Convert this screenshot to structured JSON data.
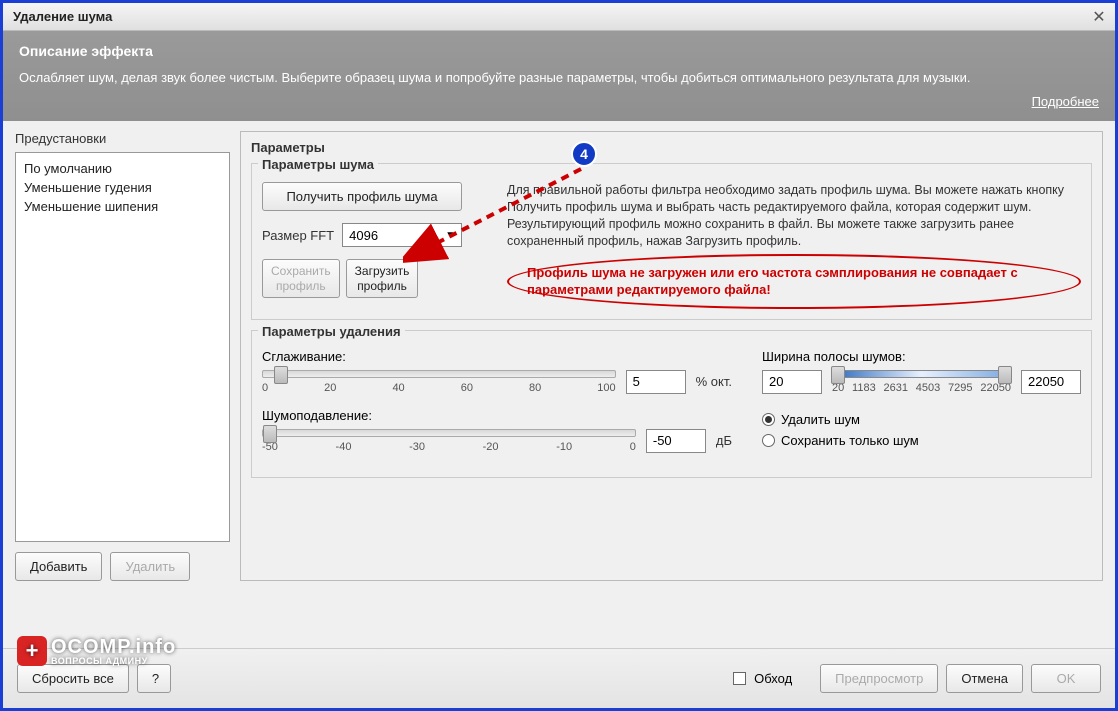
{
  "window": {
    "title": "Удаление шума"
  },
  "desc": {
    "title": "Описание эффекта",
    "text": "Ослабляет шум, делая звук более чистым. Выберите образец шума и попробуйте разные параметры, чтобы добиться оптимального результата для музыки.",
    "more": "Подробнее"
  },
  "presets": {
    "label": "Предустановки",
    "items": [
      "По умолчанию",
      "Уменьшение гудения",
      "Уменьшение шипения"
    ],
    "add": "Добавить",
    "remove": "Удалить"
  },
  "params": {
    "label": "Параметры",
    "noise": {
      "title": "Параметры шума",
      "get_profile": "Получить профиль шума",
      "fft_label": "Размер FFT",
      "fft_value": "4096",
      "save_profile": "Сохранить\nпрофиль",
      "load_profile": "Загрузить\nпрофиль",
      "info": "Для правильной работы фильтра необходимо задать профиль шума. Вы можете нажать кнопку Получить профиль шума и выбрать часть редактируемого файла, которая содержит шум. Результирующий профиль можно сохранить в файл. Вы можете также загрузить ранее сохраненный профиль, нажав Загрузить профиль.",
      "error": "Профиль шума не загружен или его частота сэмплирования не совпадает с параметрами редактируемого файла!"
    },
    "removal": {
      "title": "Параметры удаления",
      "smoothing_label": "Сглаживание:",
      "smoothing_value": "5",
      "smoothing_unit": "% окт.",
      "smoothing_ticks": [
        "0",
        "20",
        "40",
        "60",
        "80",
        "100"
      ],
      "reduction_label": "Шумоподавление:",
      "reduction_value": "-50",
      "reduction_unit": "дБ",
      "reduction_ticks": [
        "-50",
        "-40",
        "-30",
        "-20",
        "-10",
        "0"
      ],
      "bandwidth_label": "Ширина полосы шумов:",
      "bandwidth_low": "20",
      "bandwidth_high": "22050",
      "bandwidth_ticks": [
        "20",
        "1183",
        "2631",
        "4503",
        "7295",
        "22050"
      ],
      "radio_remove": "Удалить шум",
      "radio_keep": "Сохранить только шум"
    }
  },
  "bottom": {
    "reset": "Сбросить все",
    "help_icon": "?",
    "bypass": "Обход",
    "preview": "Предпросмотр",
    "cancel": "Отмена",
    "ok": "OK"
  },
  "callout": {
    "number": "4"
  },
  "watermark": {
    "brand": "OCOMP.info",
    "sub": "ВОПРОСЫ АДМИНУ"
  }
}
